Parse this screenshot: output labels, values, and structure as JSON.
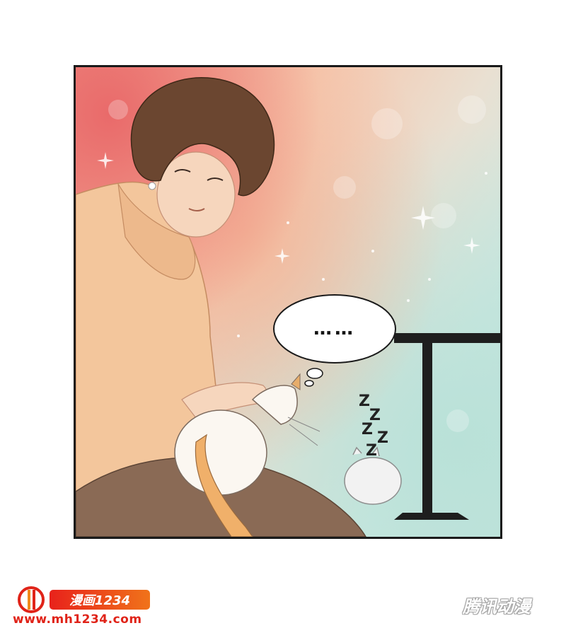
{
  "speech_bubble": {
    "text": "……"
  },
  "sleep_marks": {
    "z1": "Z",
    "z2": "Z",
    "z3": "Z",
    "z4": "Z",
    "z5": "Z"
  },
  "watermark_left": {
    "badge_text": "漫画1234",
    "url": "www.mh1234.com"
  },
  "watermark_right": {
    "text": "腾讯动漫"
  },
  "colors": {
    "border": "#1a1a1a",
    "sweater": "#f3c69c",
    "hair": "#6b4630",
    "skirt": "#8a6a55",
    "logo_red": "#e02318"
  }
}
